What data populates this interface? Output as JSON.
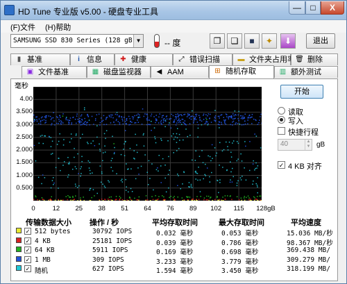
{
  "window": {
    "title": "HD Tune 专业版 v5.00 - 硬盘专业工具",
    "min_label": "—",
    "max_label": "□",
    "close_label": "X"
  },
  "menu": {
    "file": "(F)文件",
    "help": "(H)帮助"
  },
  "toolbar": {
    "drive": "SAMSUNG SSD 830 Series (128 gB)",
    "temperature": "-- 度",
    "exit_label": "退出",
    "tool_icons": [
      "copy-icon",
      "copy-alt-icon",
      "save-icon",
      "options-icon",
      "download-icon"
    ]
  },
  "tabs": {
    "row1": [
      {
        "label": "基准",
        "icon": "benchmark-icon"
      },
      {
        "label": "信息",
        "icon": "info-icon"
      },
      {
        "label": "健康",
        "icon": "health-cross-icon"
      },
      {
        "label": "错误扫描",
        "icon": "error-scan-icon"
      },
      {
        "label": "文件夹占用率",
        "icon": "folder-icon"
      },
      {
        "label": "删除",
        "icon": "erase-icon"
      }
    ],
    "row2": [
      {
        "label": "文件基准",
        "icon": "file-benchmark-icon"
      },
      {
        "label": "磁盘监视器",
        "icon": "disk-monitor-icon"
      },
      {
        "label": "AAM",
        "icon": "speaker-icon"
      },
      {
        "label": "随机存取",
        "icon": "random-access-icon"
      },
      {
        "label": "额外测试",
        "icon": "extra-tests-icon"
      }
    ],
    "active": "随机存取"
  },
  "chart_data": {
    "type": "scatter",
    "ylabel": "毫秒",
    "yticks": [
      "4.00",
      "3.500",
      "3.000",
      "2.500",
      "2.000",
      "1.500",
      "1.000",
      "0.500"
    ],
    "xticks": [
      "0",
      "12",
      "25",
      "38",
      "51",
      "64",
      "76",
      "89",
      "102",
      "115",
      "128gB"
    ],
    "xlim": [
      0,
      128
    ],
    "ylim": [
      0,
      4.5
    ],
    "series": [
      {
        "name": "512 bytes",
        "color": "#d8d838",
        "latency_ms": 0.032
      },
      {
        "name": "4 KB",
        "color": "#d82020",
        "latency_ms": 0.063
      },
      {
        "name": "64 KB",
        "color": "#20b020",
        "latency_ms": 0.169
      },
      {
        "name": "1 MB",
        "color": "#2050d8",
        "latency_ms": 3.233
      },
      {
        "name": "随机",
        "color": "#20b8c8",
        "latency_ms": 1.594
      }
    ]
  },
  "controls": {
    "start": "开始",
    "read": "读取",
    "write": "写入",
    "short_stroke": "快捷行程",
    "block_value": "40",
    "block_unit": "gB",
    "align_4k": "4 KB 对齐"
  },
  "results": {
    "headers": [
      "传输数据大小",
      "操作 / 秒",
      "平均存取时间",
      "最大存取时间",
      "平均速度"
    ],
    "rows": [
      {
        "size": "512 bytes",
        "ops": "30792 IOPS",
        "avg": "0.032 毫秒",
        "max": "0.053 毫秒",
        "speed": "15.036 MB/秒",
        "color": "#e8e830"
      },
      {
        "size": "4 KB",
        "ops": "25181 IOPS",
        "avg": "0.039 毫秒",
        "max": "0.786 毫秒",
        "speed": "98.367 MB/秒",
        "color": "#d82020"
      },
      {
        "size": "64 KB",
        "ops": "5911 IOPS",
        "avg": "0.169 毫秒",
        "max": "0.698 毫秒",
        "speed": "369.438 MB/",
        "color": "#20b020"
      },
      {
        "size": "1 MB",
        "ops": "309 IOPS",
        "avg": "3.233 毫秒",
        "max": "3.779 毫秒",
        "speed": "309.279 MB/",
        "color": "#2050d8"
      },
      {
        "size": "随机",
        "ops": "627 IOPS",
        "avg": "1.594 毫秒",
        "max": "3.450 毫秒",
        "speed": "318.199 MB/",
        "color": "#20c8d8"
      }
    ]
  }
}
